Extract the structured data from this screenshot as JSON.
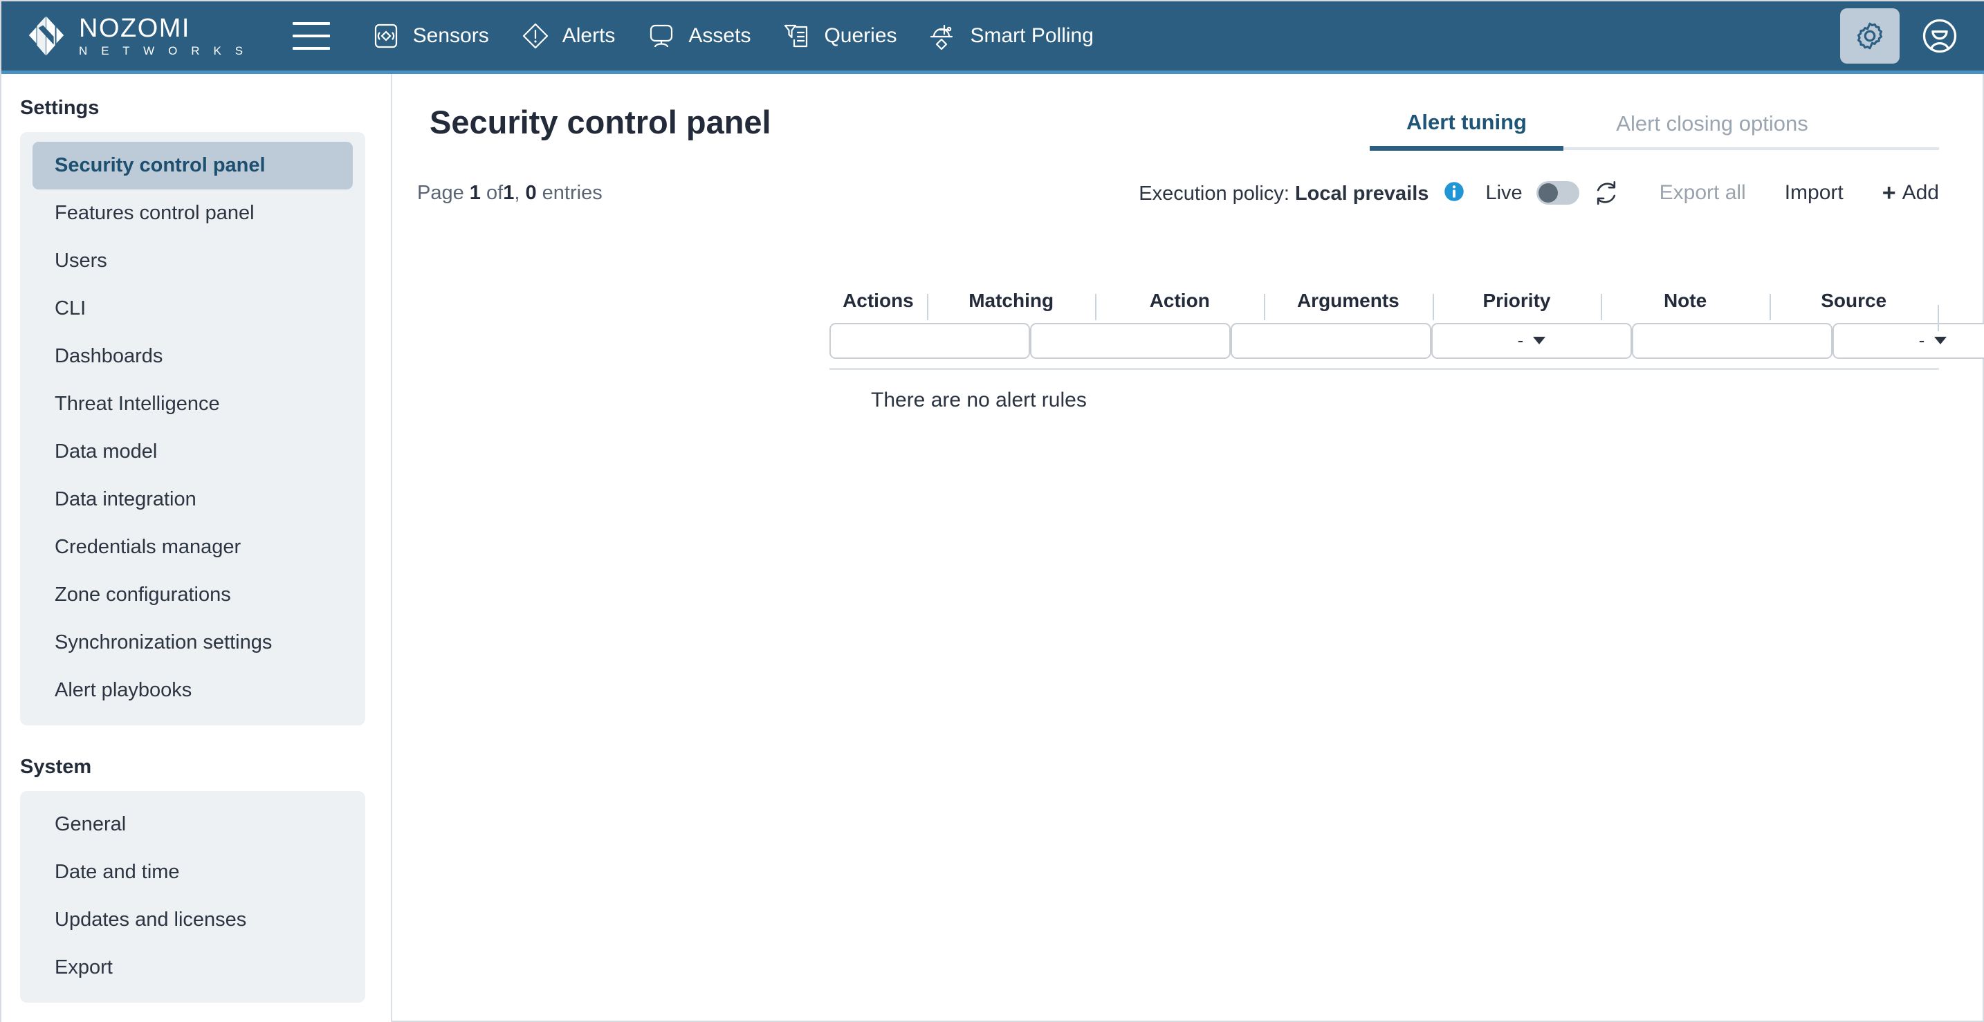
{
  "brand": {
    "name_line1": "NOZOMI",
    "name_line2": "N E T W O R K S",
    "logo_icon": "nozomi-diamond-logo"
  },
  "topnav": {
    "menu_icon": "hamburger-menu-icon",
    "items": [
      {
        "label": "Sensors",
        "icon": "sensor-icon"
      },
      {
        "label": "Alerts",
        "icon": "alert-diamond-icon"
      },
      {
        "label": "Assets",
        "icon": "monitor-icon"
      },
      {
        "label": "Queries",
        "icon": "filter-list-icon"
      },
      {
        "label": "Smart Polling",
        "icon": "smart-polling-icon"
      }
    ],
    "settings_icon": "gear-icon",
    "account_icon": "user-avatar-icon",
    "background_color": "#2b5e80",
    "accent_line_color": "#4a90c2"
  },
  "sidebar": {
    "sections": [
      {
        "heading": "Settings",
        "items": [
          {
            "label": "Security control panel",
            "active": true
          },
          {
            "label": "Features control panel",
            "active": false
          },
          {
            "label": "Users",
            "active": false
          },
          {
            "label": "CLI",
            "active": false
          },
          {
            "label": "Dashboards",
            "active": false
          },
          {
            "label": "Threat Intelligence",
            "active": false
          },
          {
            "label": "Data model",
            "active": false
          },
          {
            "label": "Data integration",
            "active": false
          },
          {
            "label": "Credentials manager",
            "active": false
          },
          {
            "label": "Zone configurations",
            "active": false
          },
          {
            "label": "Synchronization settings",
            "active": false
          },
          {
            "label": "Alert playbooks",
            "active": false
          }
        ]
      },
      {
        "heading": "System",
        "items": [
          {
            "label": "General",
            "active": false
          },
          {
            "label": "Date and time",
            "active": false
          },
          {
            "label": "Updates and licenses",
            "active": false
          },
          {
            "label": "Export",
            "active": false
          }
        ]
      }
    ],
    "active_item_color": "#bdcbd9",
    "group_background": "#edf1f4"
  },
  "page": {
    "title": "Security control panel"
  },
  "tabs": [
    {
      "label": "Alert tuning",
      "active": true
    },
    {
      "label": "Alert closing options",
      "active": false
    }
  ],
  "toolbar": {
    "page_label": "Page",
    "page_current": "1",
    "page_of": "of",
    "page_total": "1",
    "entries_count": "0",
    "entries_label": "entries",
    "execution_policy_label": "Execution policy:",
    "execution_policy_value": "Local prevails",
    "info_icon": "info-circle-icon",
    "live_label": "Live",
    "live_toggle_on": false,
    "refresh_icon": "refresh-icon",
    "export_all_label": "Export all",
    "export_all_disabled": true,
    "import_label": "Import",
    "add_plus": "+",
    "add_label": "Add"
  },
  "table": {
    "columns": [
      {
        "header": "Actions",
        "filter_type": "none"
      },
      {
        "header": "Matching",
        "filter_type": "text",
        "value": ""
      },
      {
        "header": "Action",
        "filter_type": "text",
        "value": ""
      },
      {
        "header": "Arguments",
        "filter_type": "text",
        "value": ""
      },
      {
        "header": "Priority",
        "filter_type": "select",
        "value": "-"
      },
      {
        "header": "Note",
        "filter_type": "text",
        "value": ""
      },
      {
        "header": "Source",
        "filter_type": "select",
        "value": "-"
      }
    ],
    "empty_message": "There are no alert rules",
    "rows": []
  }
}
